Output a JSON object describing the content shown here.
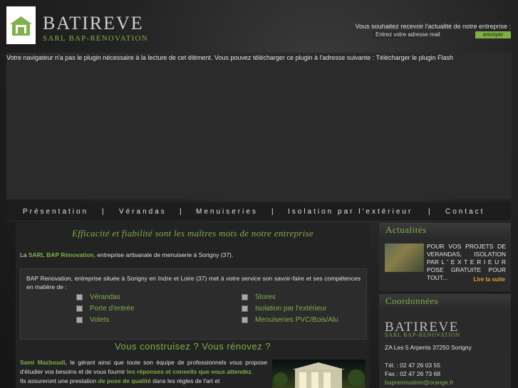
{
  "header": {
    "brand_name": "BATIREVE",
    "brand_sub": "SARL BAP-RENOVATION",
    "logo_icon": "house-icon"
  },
  "newsletter": {
    "label": "Vous souhaitez recevoir l'actualité de notre entreprise :",
    "input_value": "Entrez votre adresse mail",
    "button_label": "envoyer"
  },
  "flash": {
    "message": "Votre navigateur n'a pas le plugin nécessaire à la lecture de cet élément. Vous pouvez télécharger ce plugin à l'adresse suivante : Télécharger le plugin Flash"
  },
  "nav": {
    "items": [
      "Présentation",
      "Vérandas",
      "Menuiseries",
      "Isolation par l'extérieur",
      "Contact"
    ],
    "separator": "|"
  },
  "main": {
    "tagline": "Efficacité et fiabilité sont les maîtres mots de notre entreprise",
    "intro_prefix": "La",
    "intro_company": "SARL BAP Rénovation",
    "intro_suffix": ", entreprise artisanale de menuiserie à Sorigny (37).",
    "services_text": "BAP Renovation, entreprise située à Sorigny en Indre et Loire (37) met à votre service son savoir-faire et ses compétences en matière de :",
    "services": [
      "Vérandas",
      "Stores",
      "Porte d'entrée",
      "Isolation par l'extérieur",
      "Volets",
      "Menuiseries PVC/Bois/Alu"
    ],
    "subheading": "Vous construisez ? Vous rénovez ?",
    "about_name": "Sami Mazboudi",
    "about_text1": ", le gérant ainsi que toute son équipe de professionnels vous propose d'étudier vos besoins et de vous fournir ",
    "about_highlight": "les réponses et conseils que vous attendez",
    "about_text2": ".",
    "about_line2_start": "Ils assureront une prestation",
    "about_line2_highlight": "de pose de qualité",
    "about_line2_end": "dans les règles de l'art et"
  },
  "news": {
    "heading": "Actualités",
    "text": "POUR VOS PROJETS DE VERANDAS, ISOLATION PAR L ' E X T E R I E U R POSE GRATUITE POUR TOUT...",
    "more": "Lire la suite"
  },
  "contact": {
    "heading": "Coordonnées",
    "brand_name": "BATIREVE",
    "brand_sub": "SARL BAP-RENOVATION",
    "address": "ZA Les 5 Arpents 37250 Sorigny",
    "tel": "Tél. : 02 47 26 03 55",
    "fax": "Fax : 02 47 26 73 68",
    "email": "baprenovation@orange.fr"
  },
  "colors": {
    "accent_green": "#7fb04a",
    "link_orange": "#e0a030"
  }
}
